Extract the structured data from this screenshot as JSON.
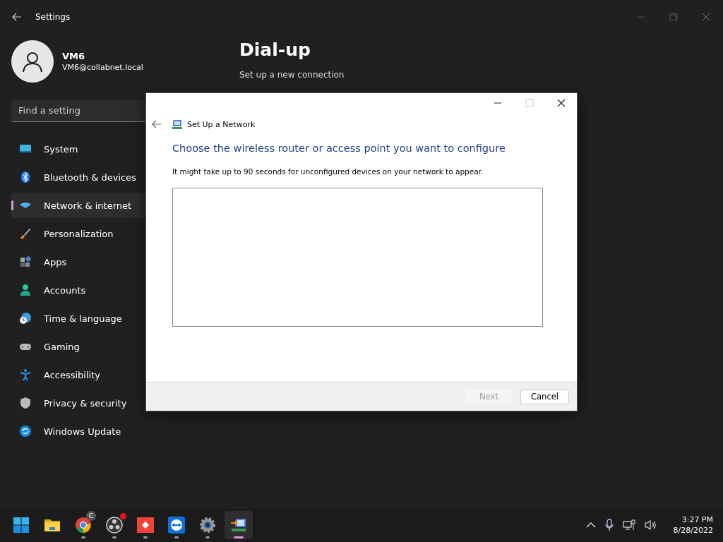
{
  "window": {
    "title": "Settings"
  },
  "user": {
    "name": "VM6",
    "email": "VM6@collabnet.local"
  },
  "search": {
    "placeholder": "Find a setting"
  },
  "sidebar": {
    "items": [
      {
        "label": "System",
        "kind": "system",
        "selected": false
      },
      {
        "label": "Bluetooth & devices",
        "kind": "bluetooth",
        "selected": false
      },
      {
        "label": "Network & internet",
        "kind": "network",
        "selected": true
      },
      {
        "label": "Personalization",
        "kind": "brush",
        "selected": false
      },
      {
        "label": "Apps",
        "kind": "apps",
        "selected": false
      },
      {
        "label": "Accounts",
        "kind": "accounts",
        "selected": false
      },
      {
        "label": "Time & language",
        "kind": "time",
        "selected": false
      },
      {
        "label": "Gaming",
        "kind": "gaming",
        "selected": false
      },
      {
        "label": "Accessibility",
        "kind": "accessibility",
        "selected": false
      },
      {
        "label": "Privacy & security",
        "kind": "privacy",
        "selected": false
      },
      {
        "label": "Windows Update",
        "kind": "update",
        "selected": false
      }
    ]
  },
  "page": {
    "title": "Dial-up",
    "link": "Set up a new connection"
  },
  "dialog": {
    "title": "Set Up a Network",
    "heading": "Choose the wireless router or access point you want to configure",
    "note": "It might take up to 90 seconds for unconfigured devices on your network to appear.",
    "maximize_disabled": true,
    "buttons": [
      {
        "label": "Next",
        "disabled": true
      },
      {
        "label": "Cancel",
        "disabled": false
      }
    ]
  },
  "taskbar": {
    "apps": [
      {
        "kind": "start",
        "running": false,
        "selected": false
      },
      {
        "kind": "folder",
        "running": false,
        "selected": false
      },
      {
        "kind": "chrome",
        "running": true,
        "selected": false,
        "badge": "C"
      },
      {
        "kind": "obs",
        "running": true,
        "selected": false,
        "alert": true
      },
      {
        "kind": "anydesk",
        "running": true,
        "selected": false
      },
      {
        "kind": "teamviewer",
        "running": true,
        "selected": false
      },
      {
        "kind": "settings",
        "running": true,
        "selected": false
      },
      {
        "kind": "netwizard",
        "running": true,
        "selected": true
      }
    ]
  },
  "tray": {
    "time": "3:27 PM",
    "date": "8/28/2022"
  }
}
